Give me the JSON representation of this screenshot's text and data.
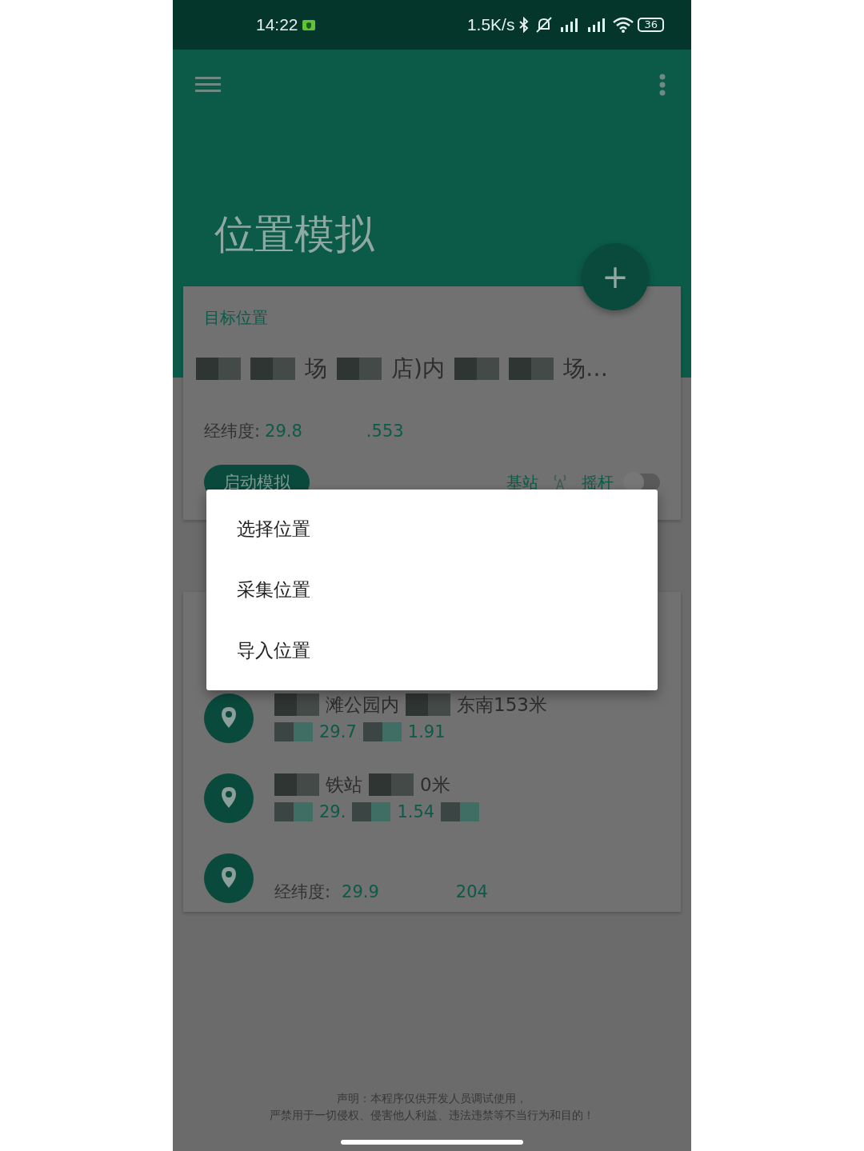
{
  "status_bar": {
    "time": "14:22",
    "net_speed": "1.5K/s",
    "battery": "36"
  },
  "app_bar": {
    "title": "位置模拟",
    "fab": "+"
  },
  "target_card": {
    "label": "目标位置",
    "address": [
      {
        "kind": "redacted"
      },
      {
        "kind": "redacted"
      },
      {
        "kind": "text",
        "text": "场"
      },
      {
        "kind": "redacted"
      },
      {
        "kind": "text",
        "text": "店)内"
      },
      {
        "kind": "redacted"
      },
      {
        "kind": "redacted"
      },
      {
        "kind": "text",
        "text": "场…"
      }
    ],
    "coord_label": "经纬度:",
    "coords": [
      {
        "kind": "text",
        "text": "29.8"
      },
      {
        "kind": "blank"
      },
      {
        "kind": "text",
        "text": ".553"
      }
    ],
    "start_button": "启动模拟",
    "cell_label": "基站",
    "joystick_label": "摇杆",
    "joystick_on": false
  },
  "locations": [
    {
      "name": [
        {
          "kind": "redacted"
        },
        {
          "kind": "text",
          "text": "滩公园内"
        },
        {
          "kind": "redacted"
        },
        {
          "kind": "text",
          "text": "东南153米"
        }
      ],
      "coords": [
        {
          "kind": "redacted"
        },
        {
          "kind": "text",
          "text": "29.7"
        },
        {
          "kind": "redacted"
        },
        {
          "kind": "text",
          "text": "1.91"
        }
      ]
    },
    {
      "name": [
        {
          "kind": "redacted"
        },
        {
          "kind": "text",
          "text": "铁站"
        },
        {
          "kind": "redacted"
        },
        {
          "kind": "text",
          "text": "0米"
        }
      ],
      "coords": [
        {
          "kind": "redacted"
        },
        {
          "kind": "text",
          "text": "29."
        },
        {
          "kind": "redacted"
        },
        {
          "kind": "text",
          "text": "1.54"
        },
        {
          "kind": "redacted"
        }
      ]
    },
    {
      "name": [
        {
          "kind": "blank"
        }
      ],
      "coords": [
        {
          "kind": "label",
          "text": "经纬度:"
        },
        {
          "kind": "text",
          "text": "29.9"
        },
        {
          "kind": "blank"
        },
        {
          "kind": "text",
          "text": "204"
        }
      ]
    }
  ],
  "menu": [
    {
      "label": "选择位置"
    },
    {
      "label": "采集位置"
    },
    {
      "label": "导入位置"
    }
  ],
  "disclaimer": [
    "声明：本程序仅供开发人员调试使用，",
    "严禁用于一切侵权、侵害他人利益、违法违禁等不当行为和目的！"
  ]
}
